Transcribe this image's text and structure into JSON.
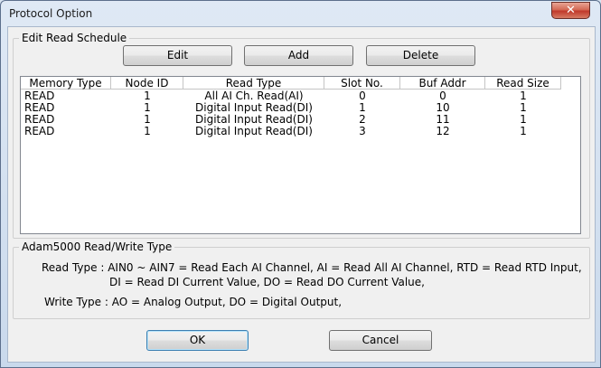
{
  "window": {
    "title": "Protocol Option",
    "close_label": "✕"
  },
  "edit_group": {
    "label": "Edit Read Schedule",
    "edit_label": "Edit",
    "add_label": "Add",
    "delete_label": "Delete"
  },
  "table": {
    "columns": [
      "Memory Type",
      "Node ID",
      "Read Type",
      "Slot No.",
      "Buf Addr",
      "Read Size"
    ],
    "rows": [
      [
        "READ",
        "1",
        "All AI Ch. Read(AI)",
        "0",
        "0",
        "1"
      ],
      [
        "READ",
        "1",
        "Digital Input Read(DI)",
        "1",
        "10",
        "1"
      ],
      [
        "READ",
        "1",
        "Digital Input Read(DI)",
        "2",
        "11",
        "1"
      ],
      [
        "READ",
        "1",
        "Digital Input Read(DI)",
        "3",
        "12",
        "1"
      ]
    ]
  },
  "info_group": {
    "label": "Adam5000 Read/Write Type",
    "read_line1": "Read Type : AIN0 ~ AIN7 = Read Each AI Channel, AI = Read All AI Channel, RTD = Read RTD Input,",
    "read_line2": "DI = Read DI Current Value, DO = Read DO Current Value,",
    "write_line": "Write Type : AO = Analog Output,  DO = Digital Output,"
  },
  "footer": {
    "ok_label": "OK",
    "cancel_label": "Cancel"
  }
}
